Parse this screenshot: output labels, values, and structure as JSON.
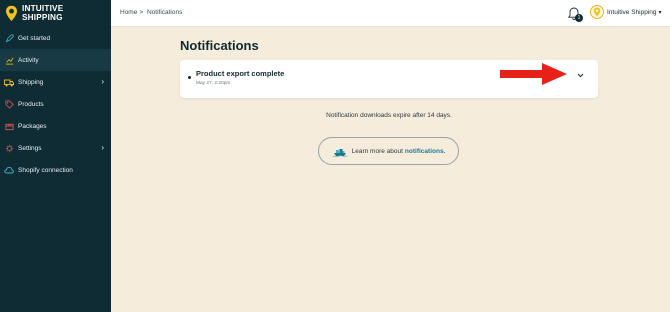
{
  "brand": {
    "line1": "INTUITIVE",
    "line2": "SHIPPING"
  },
  "breadcrumb": {
    "home": "Home",
    "separator": ">",
    "current": "Notifications"
  },
  "header": {
    "notification_count": "1",
    "account_name": "Intuitive Shipping",
    "account_caret": "▾"
  },
  "sidebar": {
    "items": [
      {
        "label": "Get started",
        "icon": "rocket-icon"
      },
      {
        "label": "Activity",
        "icon": "chart-icon",
        "active": true
      },
      {
        "label": "Shipping",
        "icon": "truck-icon",
        "has_children": true
      },
      {
        "label": "Products",
        "icon": "tag-icon"
      },
      {
        "label": "Packages",
        "icon": "box-icon"
      },
      {
        "label": "Settings",
        "icon": "gear-icon",
        "has_children": true
      },
      {
        "label": "Shopify connection",
        "icon": "cloud-icon"
      }
    ]
  },
  "main": {
    "title": "Notifications",
    "notifications": [
      {
        "title": "Product export complete",
        "time": "May 27, 2:20pm"
      }
    ],
    "expire_note": "Notification downloads expire after 14 days.",
    "learn_more": {
      "prefix": "Learn more about",
      "link": "notifications."
    }
  },
  "colors": {
    "sidebar_bg": "#0f2b33",
    "page_bg": "#f5ecdc",
    "accent": "#1a7c93",
    "annotation_arrow": "#e8201a"
  }
}
